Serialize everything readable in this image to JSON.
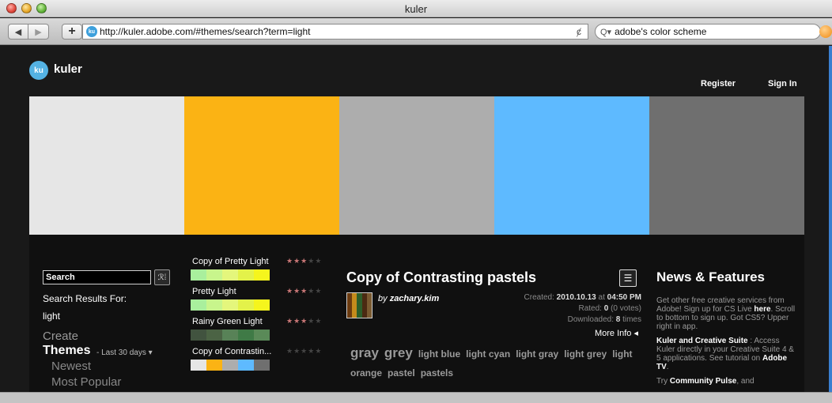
{
  "browser": {
    "window_title": "kuler",
    "url": "http://kuler.adobe.com/#themes/search?term=light",
    "reload_icon": "ȼ",
    "search_value": "adobe's color scheme"
  },
  "header": {
    "logo_badge": "ku",
    "logo_text": "kuler",
    "register": "Register",
    "signin": "Sign In"
  },
  "hero_colors": [
    "#e6e6e6",
    "#fbb314",
    "#adadad",
    "#5ebaff",
    "#6f6f6f"
  ],
  "left": {
    "search_value": "Search",
    "results_for": "Search Results For:",
    "term": "light",
    "create": "Create",
    "themes": "Themes",
    "last30": "- Last 30 days ▾",
    "newest": "Newest",
    "most_popular": "Most Popular"
  },
  "theme_list": [
    {
      "name": "Copy of Pretty Light",
      "rating": 3,
      "colors": [
        "#a9ef9d",
        "#c8f58c",
        "#e4f67c",
        "#e3f24a",
        "#f5f51d"
      ]
    },
    {
      "name": "Pretty Light",
      "rating": 3,
      "colors": [
        "#a9ef9d",
        "#c8f58c",
        "#e4f67c",
        "#e3f24a",
        "#f5f51d"
      ]
    },
    {
      "name": "Rainy Green Light",
      "rating": 3,
      "colors": [
        "#41533f",
        "#4b6344",
        "#588257",
        "#3f7a46",
        "#5a8a58"
      ]
    },
    {
      "name": "Copy of Contrastin...",
      "rating": 0,
      "colors": [
        "#e6e6e6",
        "#fbb314",
        "#adadad",
        "#5ebaff",
        "#6f6f6f"
      ]
    }
  ],
  "detail": {
    "title": "Copy of Contrasting pastels",
    "by": "by ",
    "author": "zachary.kim",
    "thumb_colors": [
      "#6b3b10",
      "#c58b1c",
      "#2c5e2a",
      "#4b2a12",
      "#7a5a30"
    ],
    "created_label": "Created:",
    "created_date": "2010.10.13",
    "at": " at ",
    "created_time": "04:50 PM",
    "rated_label": "Rated:",
    "rated_value": "0",
    "votes": " (0 votes)",
    "downloaded_label": "Downloaded:",
    "downloaded_value": "8",
    "times": " times",
    "more_info": "More Info ◂",
    "tags_big": [
      "gray",
      "grey"
    ],
    "tags_small": [
      "light blue",
      "light cyan",
      "light gray",
      "light grey",
      "light orange",
      "pastel",
      "pastels"
    ]
  },
  "news": {
    "title": "News & Features",
    "p1_a": "Get other free creative services from Adobe! Sign up for CS Live ",
    "p1_here": "here",
    "p1_b": ". Scroll to bottom to sign up. Got CS5? Upper right in app.",
    "p2_title": "Kuler and Creative Suite",
    "p2_a": " : Access Kuler directly in your Creative Suite 4 & 5 applications. See tutorial on ",
    "p2_link": "Adobe TV",
    "p2_b": ".",
    "p3_a": "Try ",
    "p3_link": "Community Pulse",
    "p3_b": ", and"
  }
}
